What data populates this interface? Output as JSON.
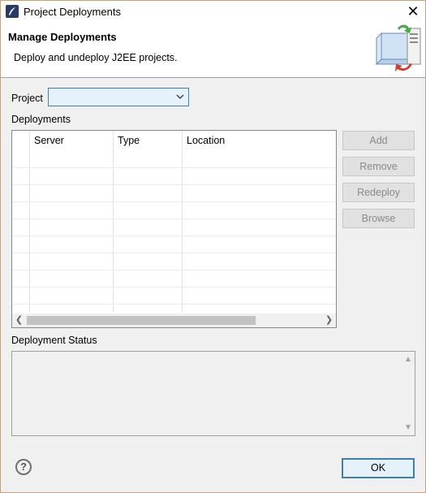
{
  "window": {
    "title": "Project Deployments",
    "close_glyph": "✕"
  },
  "header": {
    "title": "Manage Deployments",
    "description": "Deploy and undeploy J2EE projects.",
    "icon": "deploy-server-icon"
  },
  "project": {
    "label": "Project",
    "selected": ""
  },
  "deployments": {
    "label": "Deployments",
    "columns": [
      "Server",
      "Type",
      "Location"
    ],
    "rows": []
  },
  "actions": {
    "add": "Add",
    "remove": "Remove",
    "redeploy": "Redeploy",
    "browse": "Browse"
  },
  "status": {
    "label": "Deployment Status",
    "text": ""
  },
  "footer": {
    "help_glyph": "?",
    "ok": "OK"
  },
  "colors": {
    "accent": "#3c7fb1",
    "combo_bg": "#e5f1fb",
    "disabled_text": "#8a8a8a"
  }
}
